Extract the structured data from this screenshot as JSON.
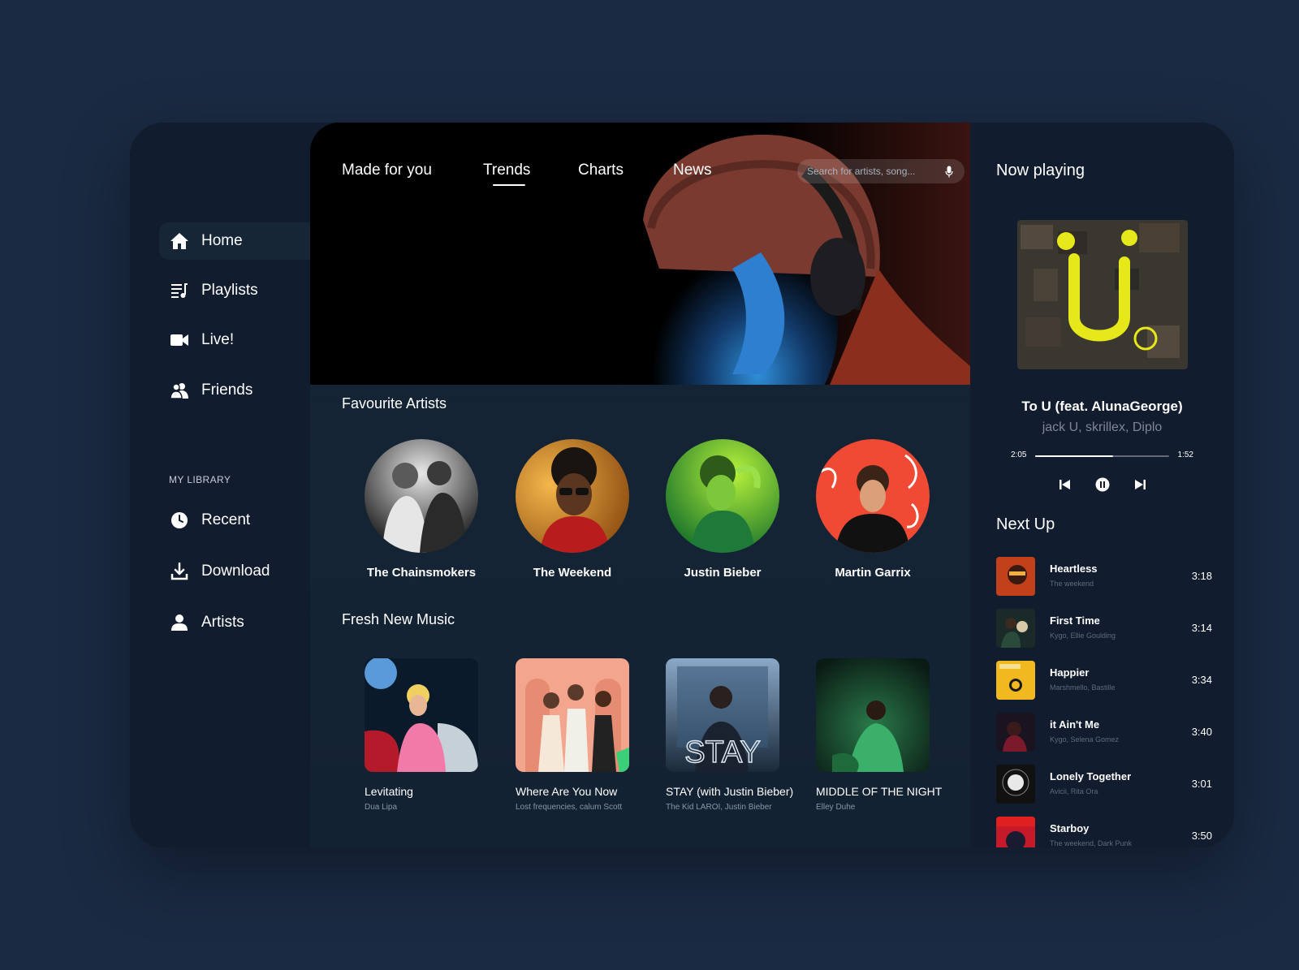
{
  "sidebar": {
    "items": [
      {
        "label": "Home",
        "icon": "home-icon"
      },
      {
        "label": "Playlists",
        "icon": "playlist-icon"
      },
      {
        "label": "Live!",
        "icon": "video-camera-icon"
      },
      {
        "label": "Friends",
        "icon": "friends-icon"
      }
    ],
    "library_heading": "MY LIBRARY",
    "library": [
      {
        "label": "Recent",
        "icon": "clock-icon"
      },
      {
        "label": "Download",
        "icon": "download-icon"
      },
      {
        "label": "Artists",
        "icon": "user-icon"
      }
    ]
  },
  "header": {
    "tabs": [
      "Made for you",
      "Trends",
      "Charts",
      "News"
    ],
    "active_tab": "Trends",
    "search_placeholder": "Search for artists, song..."
  },
  "favourite_artists": {
    "title": "Favourite Artists",
    "items": [
      "The Chainsmokers",
      "The Weekend",
      "Justin Bieber",
      "Martin Garrix"
    ]
  },
  "fresh_music": {
    "title": "Fresh New Music",
    "items": [
      {
        "title": "Levitating",
        "artist": "Dua Lipa"
      },
      {
        "title": "Where Are You Now",
        "artist": "Lost frequencies, calum Scott"
      },
      {
        "title": "STAY (with Justin Bieber)",
        "artist": "The Kid LAROI, Justin Bieber"
      },
      {
        "title": "MIDDLE OF THE NIGHT",
        "artist": "Elley Duhe"
      }
    ]
  },
  "now_playing": {
    "title": "Now playing",
    "song": "To U (feat. AlunaGeorge)",
    "artists": "jack U, skrillex, Diplo",
    "elapsed": "2:05",
    "remaining": "1:52",
    "progress": 0.58
  },
  "next_up": {
    "title": "Next Up",
    "items": [
      {
        "song": "Heartless",
        "artist": "The weekend",
        "duration": "3:18"
      },
      {
        "song": "First Time",
        "artist": "Kygo, Ellie Goulding",
        "duration": "3:14"
      },
      {
        "song": "Happier",
        "artist": "Marshmello, Bastille",
        "duration": "3:34"
      },
      {
        "song": "it Ain't Me",
        "artist": "Kygo, Selena Gomez",
        "duration": "3:40"
      },
      {
        "song": "Lonely Together",
        "artist": "Avicii, Rita Ora",
        "duration": "3:01"
      },
      {
        "song": "Starboy",
        "artist": "The weekend, Dark Punk",
        "duration": "3:50"
      }
    ]
  },
  "colors": {
    "page_bg": "#1a2a42",
    "app_bg": "#111c2e",
    "accent_text": "#ffffff",
    "muted_text": "#7d8797"
  }
}
